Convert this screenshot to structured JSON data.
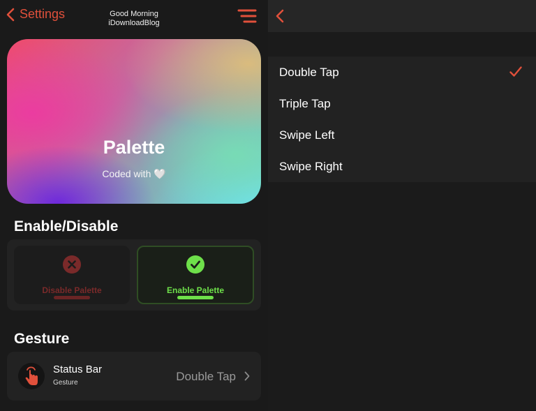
{
  "left_nav": {
    "back_label": "Settings",
    "greeting_line1": "Good Morning",
    "greeting_line2": "iDownloadBlog"
  },
  "hero": {
    "title": "Palette",
    "subtitle": "Coded with 🤍"
  },
  "sections": {
    "enable_disable_title": "Enable/Disable",
    "gesture_title": "Gesture"
  },
  "toggle": {
    "disable_label": "Disable Palette",
    "enable_label": "Enable Palette",
    "selected": "enable"
  },
  "gesture_row": {
    "title": "Status Bar",
    "subtitle": "Gesture",
    "value": "Double Tap"
  },
  "gesture_options": {
    "items": [
      "Double Tap",
      "Triple Tap",
      "Swipe Left",
      "Swipe Right"
    ],
    "selected": "Double Tap"
  },
  "colors": {
    "accent": "#e0503b",
    "enabled_green": "#6ee04a",
    "disabled_red": "#7a2a2a"
  },
  "icons": {
    "back": "chevron-left-icon",
    "menu": "menu-lines-icon",
    "disable": "x-circle-icon",
    "enable": "check-circle-icon",
    "gesture": "tap-hand-icon",
    "row_chevron": "chevron-right-icon",
    "checkmark": "checkmark-icon"
  }
}
